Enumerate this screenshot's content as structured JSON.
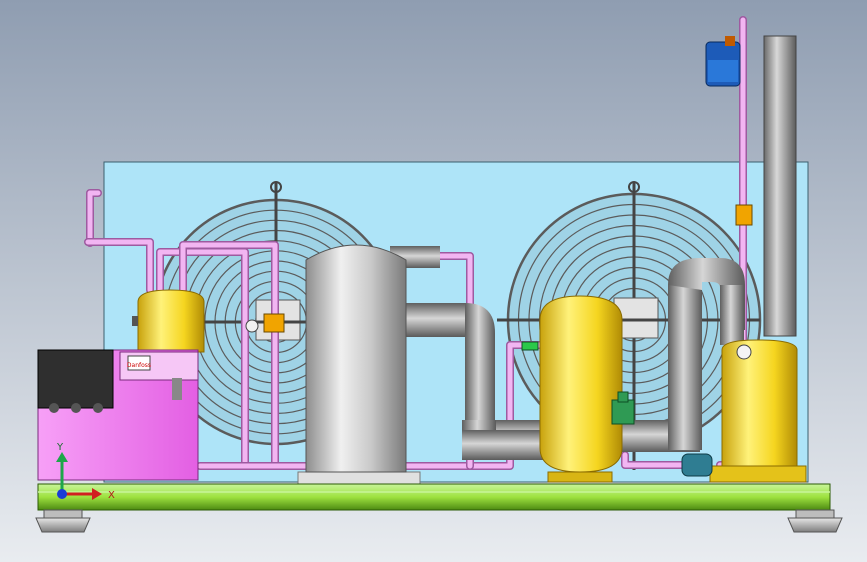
{
  "viewport": {
    "background_top": "#8f9db1",
    "background_bottom": "#e9ecf0"
  },
  "colors": {
    "backplate": "#aee4f8",
    "base_frame": "#9ee23f",
    "base_frame_dark": "#4d8a12",
    "control_box": "#ef6bef",
    "control_box_dark": "#b93fbb",
    "display_panel": "#2f2f2f",
    "vessel_yellow": "#f5d51f",
    "vessel_yellow_dark": "#c8a20c",
    "compressor_silver": "#c9c9c9",
    "suction_pipe_grey": "#9a9a9a",
    "pink_pipe": "#f2b5f2",
    "solenoid_blue": "#1d5bb8",
    "pump_teal": "#2f7d92",
    "valve_green": "#2f9a54",
    "fan_guard": "#5b5b5b"
  },
  "labels": {
    "axis_x": "X",
    "axis_y": "Y",
    "brand_mark": "Danfoss"
  },
  "icons": {
    "triad": "xyz-axis-triad-icon",
    "brand": "danfoss-logo-icon"
  },
  "structure": {
    "fans": 2,
    "fan_guard_rings": 12,
    "support_feet": 2
  }
}
